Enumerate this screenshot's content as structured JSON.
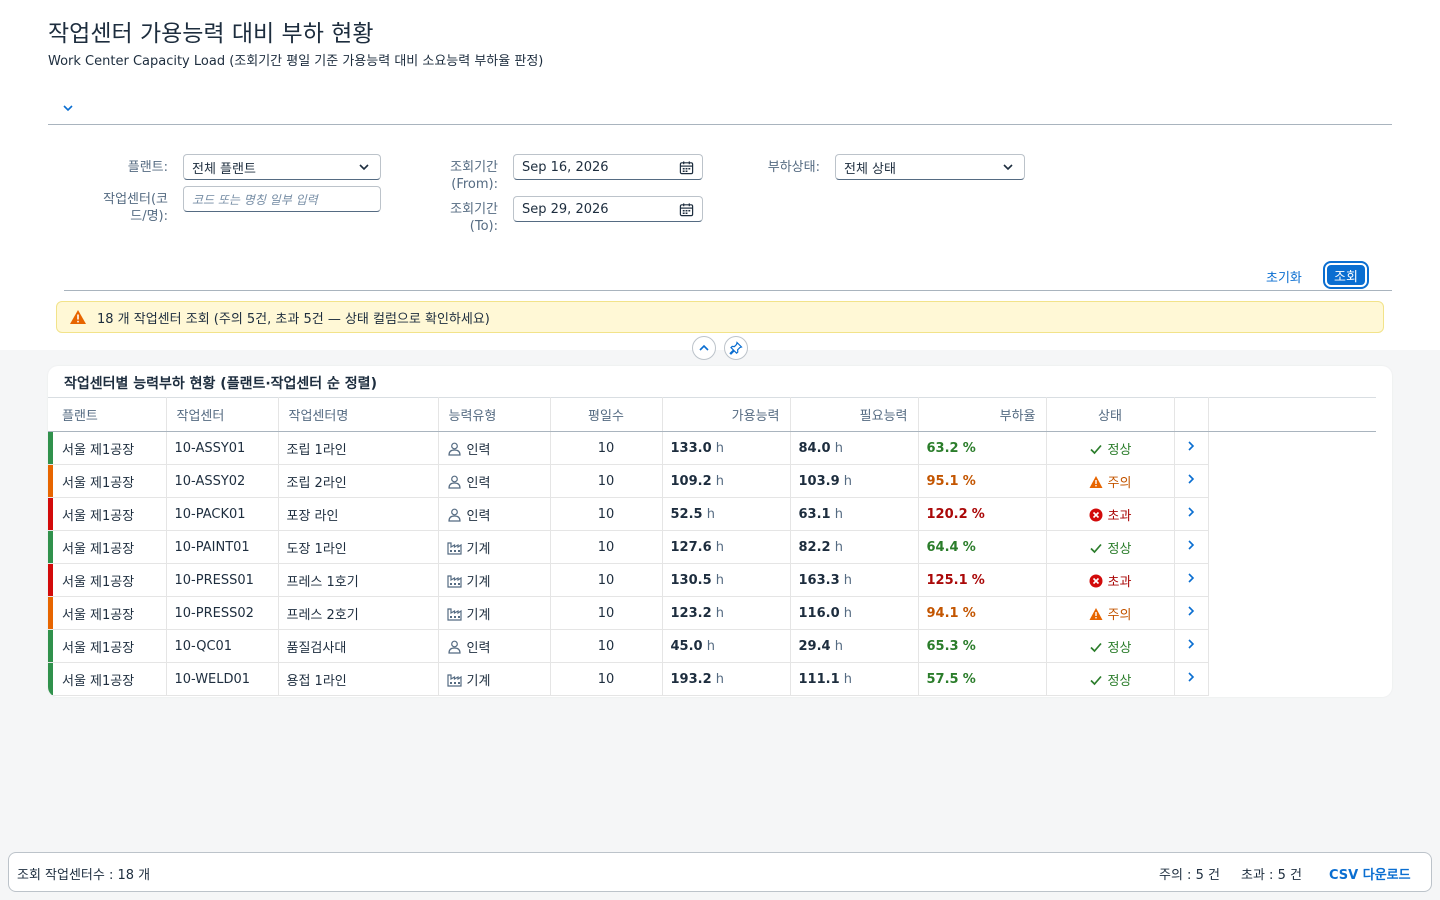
{
  "page": {
    "title": "작업센터 가용능력 대비 부하 현황",
    "subtitle": "Work Center Capacity Load (조회기간 평일 기준 가용능력 대비 소요능력 부하율 판정)"
  },
  "filters": {
    "plant_label": "플랜트:",
    "plant_value": "전체 플랜트",
    "wc_label_line1": "작업센터(코",
    "wc_label_line2": "드/명):",
    "wc_placeholder": "코드 또는 명칭 일부 입력",
    "from_label_line1": "조회기간",
    "from_label_line2": "(From):",
    "from_value": "Sep 16, 2026",
    "to_label_line1": "조회기간",
    "to_label_line2": "(To):",
    "to_value": "Sep 29, 2026",
    "status_label": "부하상태:",
    "status_value": "전체 상태",
    "reset_label": "초기화",
    "search_label": "조회"
  },
  "alert": {
    "text": "18 개 작업센터 조회 (주의 5건, 초과 5건 — 상태 컬럼으로 확인하세요)"
  },
  "table": {
    "title": "작업센터별 능력부하 현황 (플랜트·작업센터 순 정렬)",
    "columns": [
      "플랜트",
      "작업센터",
      "작업센터명",
      "능력유형",
      "평일수",
      "가용능력",
      "필요능력",
      "부하율",
      "상태"
    ],
    "unit": "h",
    "pct": "%",
    "rows": [
      {
        "plant": "서울 제1공장",
        "wc": "10-ASSY01",
        "name": "조립 1라인",
        "type": "인력",
        "type_icon": "person-icon",
        "days": "10",
        "avail": "133.0",
        "req": "84.0",
        "rate": "63.2",
        "status": "정상",
        "state": "ok"
      },
      {
        "plant": "서울 제1공장",
        "wc": "10-ASSY02",
        "name": "조립 2라인",
        "type": "인력",
        "type_icon": "person-icon",
        "days": "10",
        "avail": "109.2",
        "req": "103.9",
        "rate": "95.1",
        "status": "주의",
        "state": "warn"
      },
      {
        "plant": "서울 제1공장",
        "wc": "10-PACK01",
        "name": "포장 라인",
        "type": "인력",
        "type_icon": "person-icon",
        "days": "10",
        "avail": "52.5",
        "req": "63.1",
        "rate": "120.2",
        "status": "초과",
        "state": "over"
      },
      {
        "plant": "서울 제1공장",
        "wc": "10-PAINT01",
        "name": "도장 1라인",
        "type": "기계",
        "type_icon": "factory-icon",
        "days": "10",
        "avail": "127.6",
        "req": "82.2",
        "rate": "64.4",
        "status": "정상",
        "state": "ok"
      },
      {
        "plant": "서울 제1공장",
        "wc": "10-PRESS01",
        "name": "프레스 1호기",
        "type": "기계",
        "type_icon": "factory-icon",
        "days": "10",
        "avail": "130.5",
        "req": "163.3",
        "rate": "125.1",
        "status": "초과",
        "state": "over"
      },
      {
        "plant": "서울 제1공장",
        "wc": "10-PRESS02",
        "name": "프레스 2호기",
        "type": "기계",
        "type_icon": "factory-icon",
        "days": "10",
        "avail": "123.2",
        "req": "116.0",
        "rate": "94.1",
        "status": "주의",
        "state": "warn"
      },
      {
        "plant": "서울 제1공장",
        "wc": "10-QC01",
        "name": "품질검사대",
        "type": "인력",
        "type_icon": "person-icon",
        "days": "10",
        "avail": "45.0",
        "req": "29.4",
        "rate": "65.3",
        "status": "정상",
        "state": "ok"
      },
      {
        "plant": "서울 제1공장",
        "wc": "10-WELD01",
        "name": "용접 1라인",
        "type": "기계",
        "type_icon": "factory-icon",
        "days": "10",
        "avail": "193.2",
        "req": "111.1",
        "rate": "57.5",
        "status": "정상",
        "state": "ok"
      }
    ]
  },
  "footer": {
    "count_text": "조회 작업센터수 : 18 개",
    "warn_text": "주의 : 5 건",
    "over_text": "초과 : 5 건",
    "csv_label": "CSV 다운로드"
  },
  "colors": {
    "ok": "#2b7d2b",
    "warn": "#c35500",
    "over": "#aa0808",
    "bar_ok": "#30914c",
    "bar_warn": "#e76500",
    "bar_over": "#d20a0a",
    "accent": "#0a6ed1"
  }
}
